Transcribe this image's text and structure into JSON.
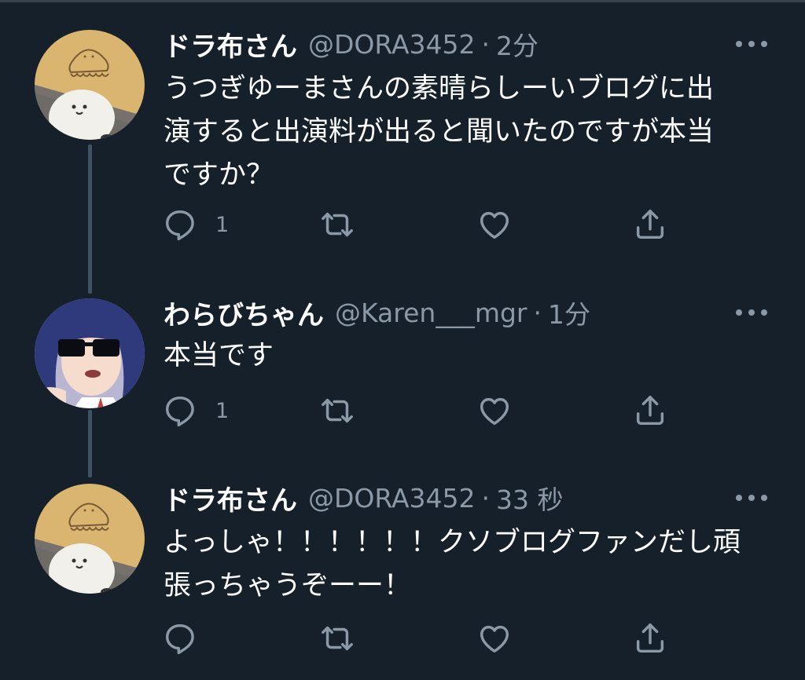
{
  "tweets": [
    {
      "name": "ドラ布さん",
      "handle": "@DORA3452",
      "separator": "·",
      "time": "2分",
      "text": "うつぎゆーまさんの素晴らしーいブログに出\n演すると出演料が出ると聞いたのですが本当\nですか？",
      "reply_count": "1",
      "avatar": "bear-avatar"
    },
    {
      "name": "わらびちゃん",
      "handle": "@Karen___mgr",
      "separator": "·",
      "time": "1分",
      "text": "本当です",
      "reply_count": "1",
      "avatar": "anime-girl-sunglasses-avatar"
    },
    {
      "name": "ドラ布さん",
      "handle": "@DORA3452",
      "separator": "·",
      "time": "33 秒",
      "text": "よっしゃ！！！！！！クソブログファンだし頑\n張っちゃうぞーー！",
      "reply_count": "",
      "avatar": "bear-avatar"
    }
  ],
  "colors": {
    "background": "#15202b",
    "secondary_text": "#8b98a5",
    "thread_line": "#3d5466"
  }
}
